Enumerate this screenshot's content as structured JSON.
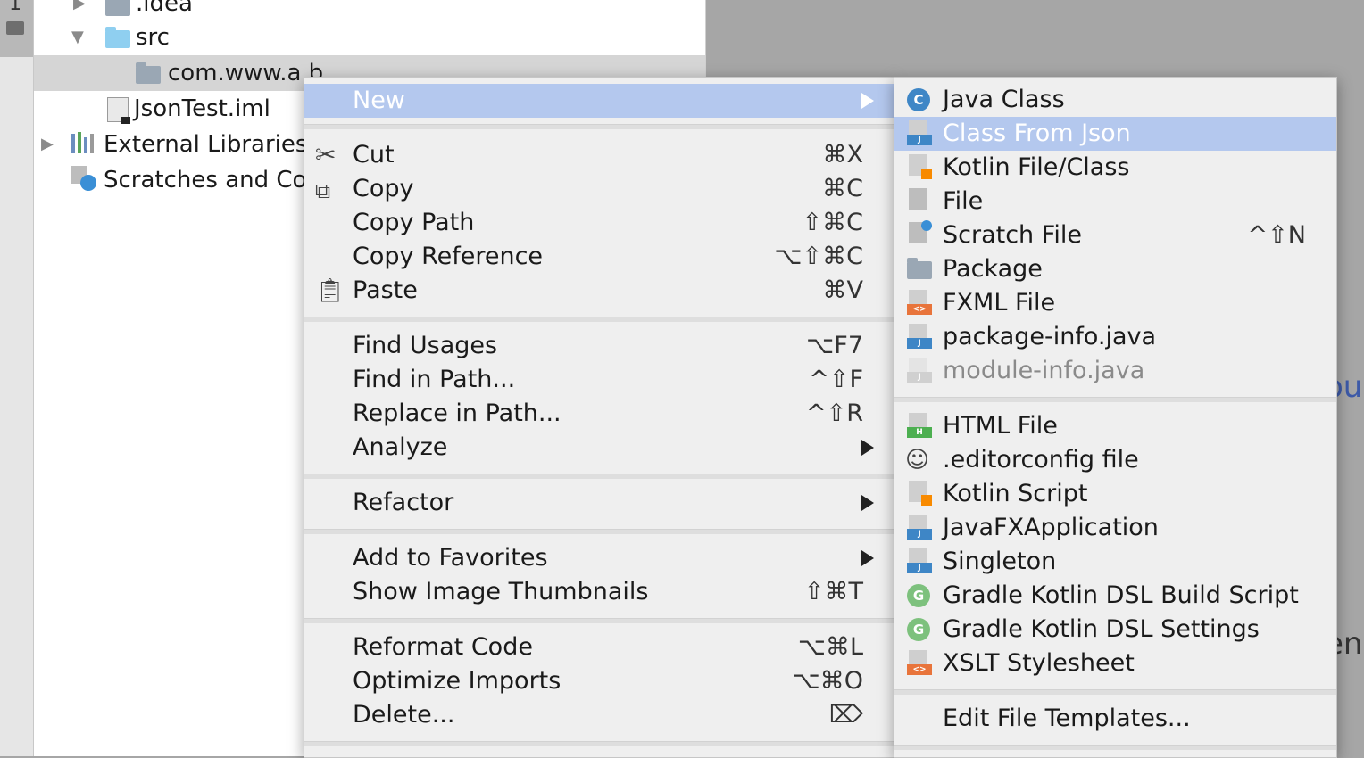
{
  "tool_strip": {
    "tab_number": "1"
  },
  "project_tree": {
    "rows": [
      {
        "label": ".idea"
      },
      {
        "label": "src"
      },
      {
        "label": "com.www.a.b"
      },
      {
        "label": "JsonTest.iml"
      },
      {
        "label": "External Libraries"
      },
      {
        "label": "Scratches and Consoles"
      }
    ]
  },
  "editor_fragments": [
    "oul",
    "en"
  ],
  "context_menu": {
    "items": [
      {
        "label": "New",
        "shortcut": "",
        "submenu": true
      },
      {
        "label": "Cut",
        "shortcut": "⌘X",
        "icon": "scissors-icon"
      },
      {
        "label": "Copy",
        "shortcut": "⌘C",
        "icon": "copy-icon"
      },
      {
        "label": "Copy Path",
        "shortcut": "⇧⌘C"
      },
      {
        "label": "Copy Reference",
        "shortcut": "⌥⇧⌘C"
      },
      {
        "label": "Paste",
        "shortcut": "⌘V",
        "icon": "clipboard-icon"
      },
      {
        "label": "Find Usages",
        "shortcut": "⌥F7"
      },
      {
        "label": "Find in Path...",
        "shortcut": "^⇧F"
      },
      {
        "label": "Replace in Path...",
        "shortcut": "^⇧R"
      },
      {
        "label": "Analyze",
        "shortcut": "",
        "submenu": true
      },
      {
        "label": "Refactor",
        "shortcut": "",
        "submenu": true
      },
      {
        "label": "Add to Favorites",
        "shortcut": "",
        "submenu": true
      },
      {
        "label": "Show Image Thumbnails",
        "shortcut": "⇧⌘T"
      },
      {
        "label": "Reformat Code",
        "shortcut": "⌥⌘L"
      },
      {
        "label": "Optimize Imports",
        "shortcut": "⌥⌘O"
      },
      {
        "label": "Delete...",
        "shortcut": "⌦"
      }
    ]
  },
  "submenu_new": {
    "items": [
      {
        "label": "Java Class",
        "icon": "java-class-icon",
        "badge": "C"
      },
      {
        "label": "Class From Json",
        "icon": "java-file-icon",
        "badge": "J"
      },
      {
        "label": "Kotlin File/Class",
        "icon": "kotlin-file-icon"
      },
      {
        "label": "File",
        "icon": "text-file-icon"
      },
      {
        "label": "Scratch File",
        "icon": "scratch-file-icon",
        "shortcut": "^⇧N"
      },
      {
        "label": "Package",
        "icon": "package-icon"
      },
      {
        "label": "FXML File",
        "icon": "fxml-file-icon",
        "badge": "<>"
      },
      {
        "label": "package-info.java",
        "icon": "java-file-icon",
        "badge": "J"
      },
      {
        "label": "module-info.java",
        "icon": "java-file-icon",
        "badge": "J"
      },
      {
        "label": "HTML File",
        "icon": "html-file-icon",
        "badge": "H"
      },
      {
        "label": ".editorconfig file",
        "icon": "editorconfig-icon"
      },
      {
        "label": "Kotlin Script",
        "icon": "kotlin-script-icon"
      },
      {
        "label": "JavaFXApplication",
        "icon": "java-file-icon",
        "badge": "J"
      },
      {
        "label": "Singleton",
        "icon": "java-file-icon",
        "badge": "J"
      },
      {
        "label": "Gradle Kotlin DSL Build Script",
        "icon": "gradle-icon",
        "badge": "G"
      },
      {
        "label": "Gradle Kotlin DSL Settings",
        "icon": "gradle-icon",
        "badge": "G"
      },
      {
        "label": "XSLT Stylesheet",
        "icon": "xslt-file-icon",
        "badge": "<>"
      },
      {
        "label": "Edit File Templates..."
      }
    ]
  },
  "colors": {
    "highlight": "#b4c8ee",
    "menu_bg": "#efefef",
    "java_badge": "#3e86c6",
    "gradle_badge": "#7dc17d",
    "xml_badge": "#e8743b",
    "html_badge": "#4caf50",
    "kotlin": "#f88a00"
  }
}
